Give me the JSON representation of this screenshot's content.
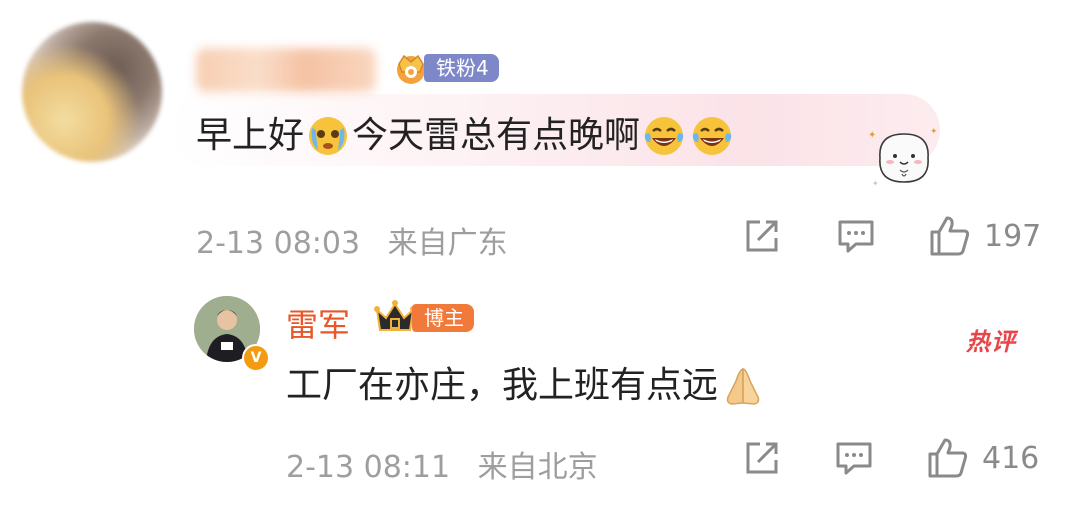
{
  "comments": [
    {
      "author": "",
      "fan_badge_label": "铁粉4",
      "text_parts": [
        "早上好",
        "今天雷总有点晚啊"
      ],
      "date": "2-13 08:03",
      "location": "来自广东",
      "likes": "197"
    },
    {
      "author": "雷军",
      "host_badge_label": "博主",
      "hot_label": "热评",
      "verified_mark": "V",
      "text": "工厂在亦庄，我上班有点远",
      "date": "2-13 08:11",
      "location": "来自北京",
      "likes": "416"
    }
  ],
  "colors": {
    "fan_badge": "#7e88c8",
    "host_badge": "#f17a3a",
    "author_name": "#e8572a",
    "hot_label": "#e8464b",
    "meta_text": "#9e9e9e"
  },
  "icons": [
    "share-icon",
    "comment-icon",
    "like-icon",
    "crying-emoji-icon",
    "laughing-tears-emoji-icon",
    "praying-hands-emoji-icon",
    "crown-icon"
  ]
}
